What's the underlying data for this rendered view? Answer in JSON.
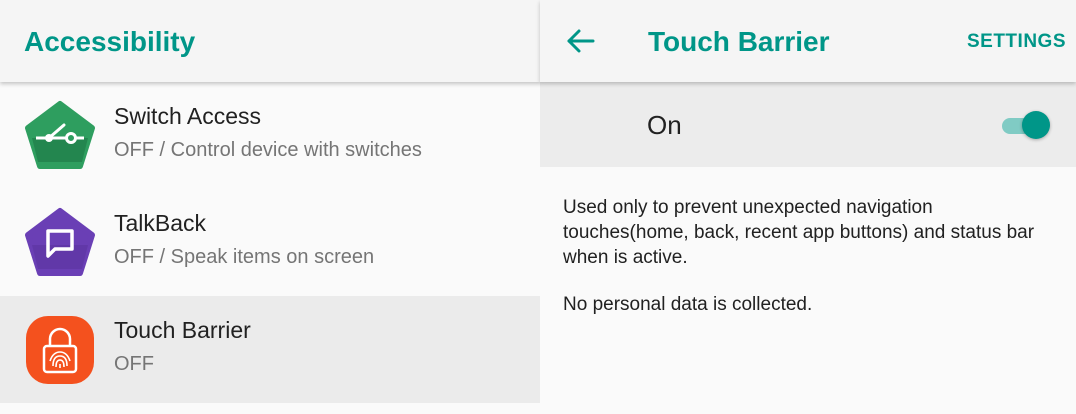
{
  "left_pane": {
    "title": "Accessibility",
    "items": [
      {
        "title": "Switch Access",
        "subtitle": "OFF / Control device with switches",
        "icon": "switch-access-icon",
        "color": "#2e9e5f"
      },
      {
        "title": "TalkBack",
        "subtitle": "OFF / Speak items on screen",
        "icon": "talkback-icon",
        "color": "#6a3fb5"
      },
      {
        "title": "Touch Barrier",
        "subtitle": "OFF",
        "icon": "touch-barrier-icon",
        "color": "#f4511e"
      }
    ]
  },
  "right_pane": {
    "title": "Touch Barrier",
    "settings_label": "SETTINGS",
    "master_switch": {
      "label": "On",
      "state": true
    },
    "description": "Used only to prevent unexpected navigation touches(home, back, recent app buttons) and status bar when is active.",
    "privacy_note": "No personal data is collected."
  },
  "colors": {
    "accent": "#009688",
    "accent_light": "#80cbc4",
    "selected_row": "#ebebeb"
  }
}
